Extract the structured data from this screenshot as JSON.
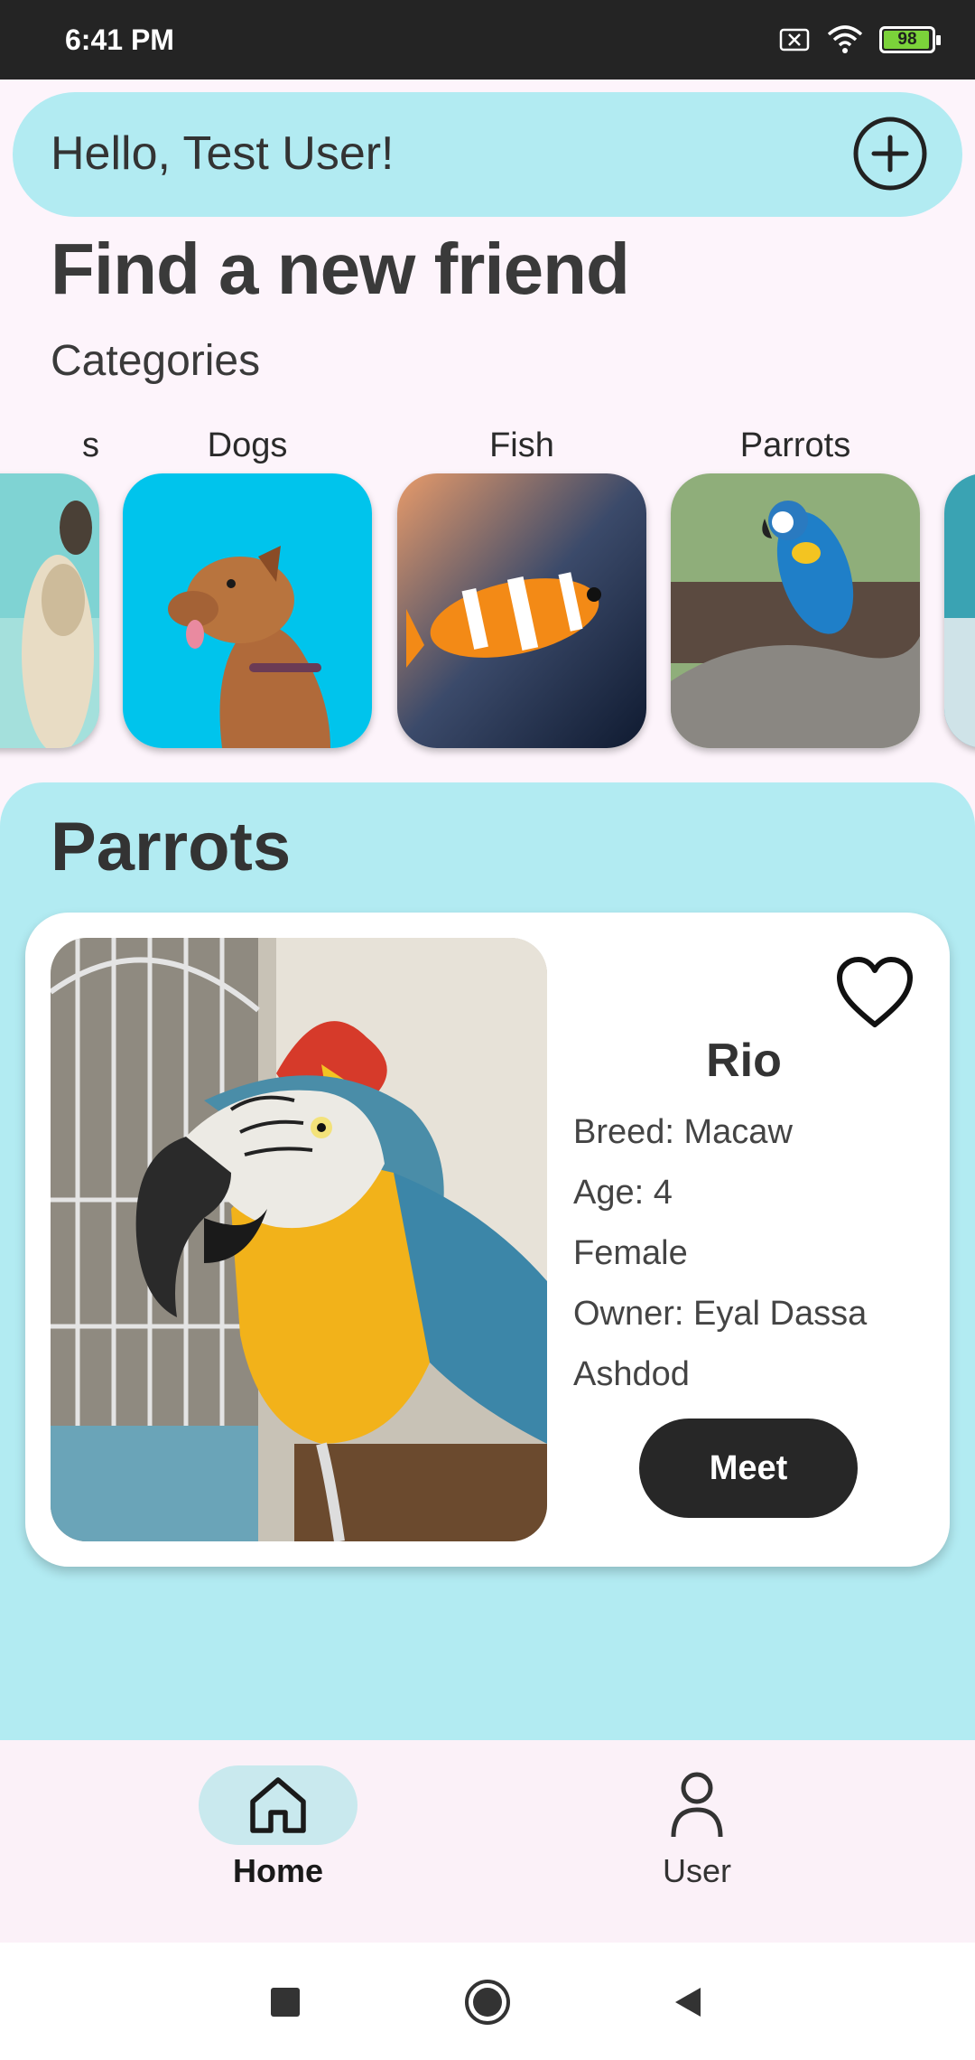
{
  "status_bar": {
    "time": "6:41 PM",
    "battery": "98",
    "battery_level": 0.98
  },
  "header": {
    "greeting": "Hello, Test User!"
  },
  "page": {
    "title": "Find a new friend",
    "categories_label": "Categories"
  },
  "categories": [
    {
      "label": "s",
      "image": "cat-photo"
    },
    {
      "label": "Dogs",
      "image": "dog-photo"
    },
    {
      "label": "Fish",
      "image": "fish-photo"
    },
    {
      "label": "Parrots",
      "image": "parrot-photo"
    },
    {
      "label": "",
      "image": "next-category-photo"
    }
  ],
  "results": {
    "title": "Parrots",
    "pets": [
      {
        "name": "Rio",
        "breed": "Breed: Macaw",
        "age": "Age: 4",
        "gender": "Female",
        "owner": "Owner: Eyal Dassa",
        "location": "Ashdod",
        "button": "Meet",
        "favorite_icon": "heart-outline-icon"
      }
    ]
  },
  "bottom_nav": {
    "items": [
      {
        "label": "Home",
        "icon": "home-icon",
        "active": true
      },
      {
        "label": "User",
        "icon": "user-icon",
        "active": false
      }
    ]
  },
  "colors": {
    "accent": "#b2ebf2",
    "background": "#fdf4fb",
    "button": "#272727"
  }
}
